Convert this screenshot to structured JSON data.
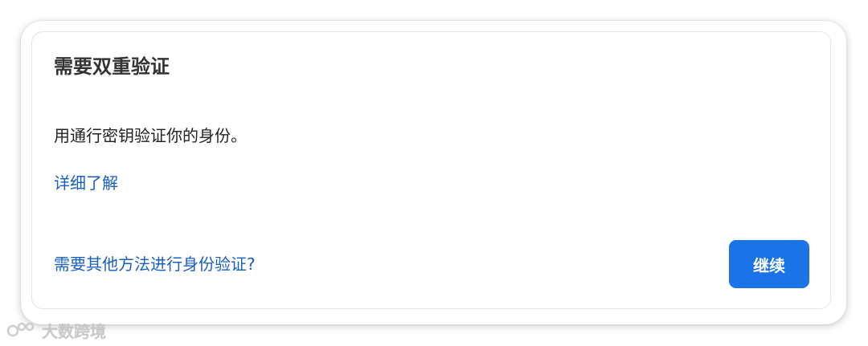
{
  "dialog": {
    "title": "需要双重验证",
    "message": "用通行密钥验证你的身份。",
    "learn_more_link": "详细了解",
    "alt_method_link": "需要其他方法进行身份验证?",
    "continue_button": "继续"
  },
  "watermark": {
    "text": "大数跨境",
    "logo_icon": "watermark-logo-icon"
  },
  "colors": {
    "primary_button": "#1b73e8",
    "link": "#1a5fc2",
    "title": "#333333"
  }
}
